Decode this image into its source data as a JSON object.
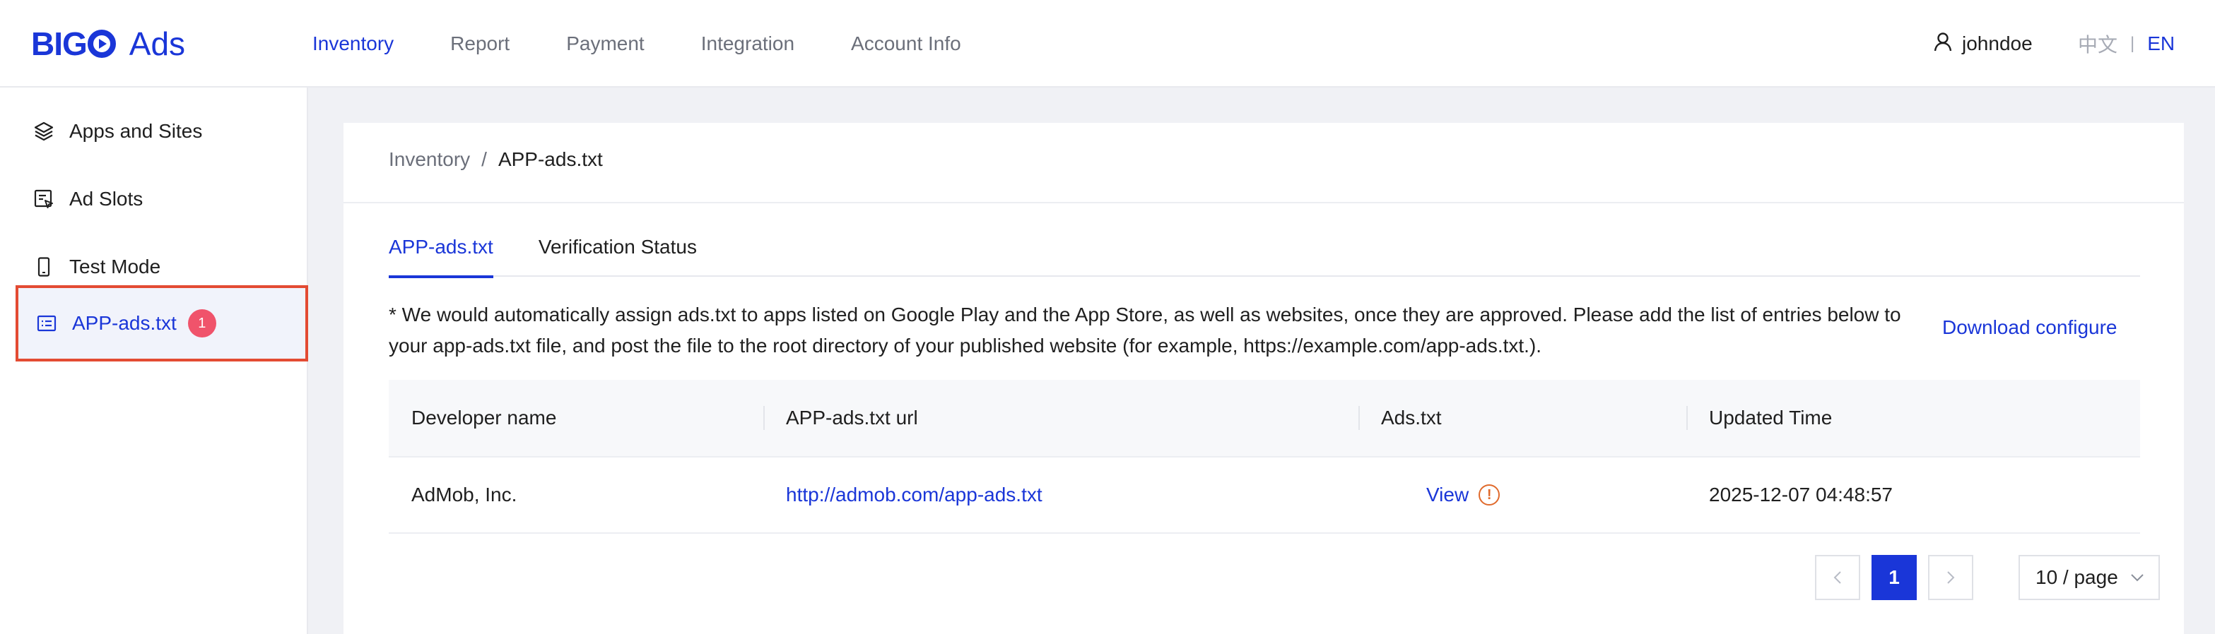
{
  "header": {
    "logo_text": "BIGO Ads",
    "nav": [
      {
        "label": "Inventory",
        "active": true
      },
      {
        "label": "Report",
        "active": false
      },
      {
        "label": "Payment",
        "active": false
      },
      {
        "label": "Integration",
        "active": false
      },
      {
        "label": "Account Info",
        "active": false
      }
    ],
    "username": "johndoe",
    "lang_zh": "中文",
    "lang_sep": "|",
    "lang_en": "EN"
  },
  "sidebar": {
    "items": [
      {
        "label": "Apps and Sites",
        "icon": "layers-icon"
      },
      {
        "label": "Ad Slots",
        "icon": "ad-slot-icon"
      },
      {
        "label": "Test Mode",
        "icon": "phone-icon"
      },
      {
        "label": "APP-ads.txt",
        "icon": "document-list-icon",
        "active": true,
        "badge": "1"
      }
    ]
  },
  "breadcrumb": {
    "parent": "Inventory",
    "separator": "/",
    "current": "APP-ads.txt"
  },
  "tabs": [
    {
      "label": "APP-ads.txt",
      "active": true
    },
    {
      "label": "Verification Status",
      "active": false
    }
  ],
  "notice": "* We would automatically assign ads.txt to apps listed on Google Play and the App Store, as well as websites, once they are approved. Please add the list of entries below to your app-ads.txt file, and post the file to the root directory of your published website (for example, https://example.com/app-ads.txt.).",
  "download_label": "Download configure",
  "table": {
    "columns": [
      "Developer name",
      "APP-ads.txt url",
      "Ads.txt",
      "Updated Time"
    ],
    "rows": [
      {
        "developer": "AdMob, Inc.",
        "url": "http://admob.com/app-ads.txt",
        "ads_txt": "View",
        "updated": "2025-12-07 04:48:57"
      }
    ]
  },
  "pagination": {
    "prev": "<",
    "current_page": "1",
    "next": ">",
    "page_size": "10 / page"
  },
  "colors": {
    "accent": "#1a36d8",
    "badge": "#f0536b",
    "highlight_border": "#e34b33",
    "warning": "#e06a2c"
  }
}
